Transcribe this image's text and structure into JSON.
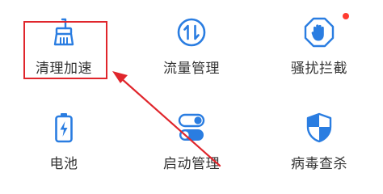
{
  "colors": {
    "accent": "#2a7de1",
    "annotation": "#e0262c",
    "badge": "#ff3b30",
    "text": "#333333"
  },
  "tiles": [
    {
      "label": "清理加速",
      "icon": "broom-icon"
    },
    {
      "label": "流量管理",
      "icon": "data-transfer-icon"
    },
    {
      "label": "骚扰拦截",
      "icon": "hand-stop-icon",
      "badge": true
    },
    {
      "label": "电池",
      "icon": "battery-icon"
    },
    {
      "label": "启动管理",
      "icon": "toggle-switches-icon"
    },
    {
      "label": "病毒查杀",
      "icon": "shield-icon"
    }
  ]
}
